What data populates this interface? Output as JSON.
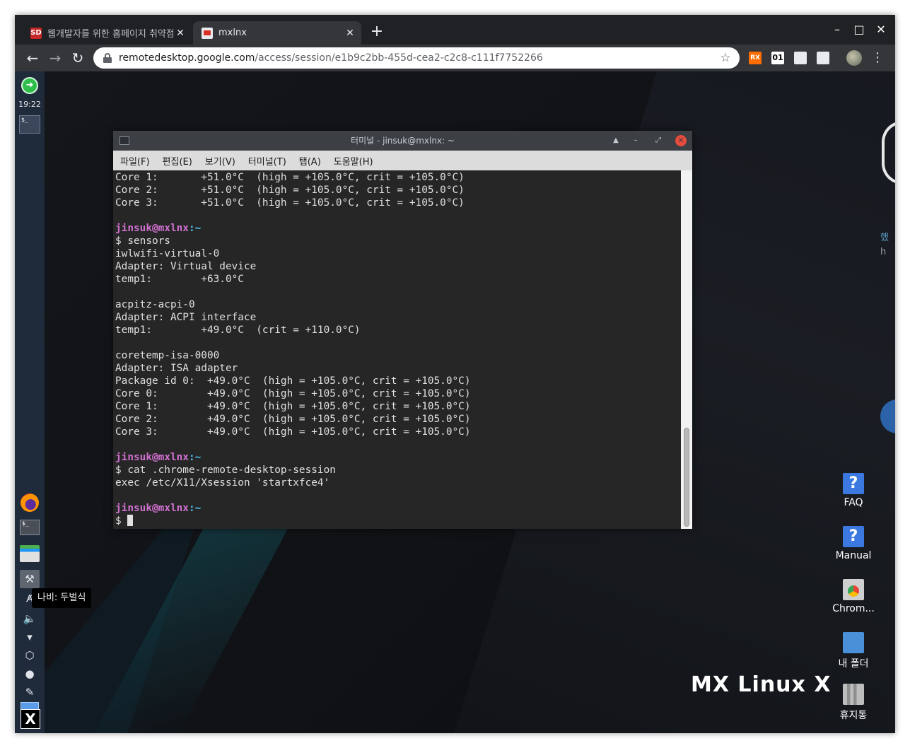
{
  "browser": {
    "tabs": [
      {
        "title": "웹개발자를 위한 홈페이지 취약점",
        "favicon": "sd-logo-icon",
        "close": "✕"
      },
      {
        "title": "mxlnx",
        "favicon": "chrome-remote-desktop-icon",
        "close": "✕"
      }
    ],
    "new_tab": "+",
    "window_controls": {
      "minimize": "–",
      "maximize": "□",
      "close": "✕"
    },
    "nav": {
      "back": "←",
      "forward": "→",
      "reload": "↻"
    },
    "url_host": "remotedesktop.google.com",
    "url_path": "/access/session/e1b9c2bb-455d-cea2-c2c8-c111f7752266",
    "star": "☆",
    "extensions": [
      {
        "name": "rx-extension-icon",
        "label": "RX"
      },
      {
        "name": "counter-extension-icon",
        "label": "01"
      },
      {
        "name": "remote-desktop-extension-icon",
        "label": ""
      },
      {
        "name": "cast-extension-icon",
        "label": ""
      }
    ],
    "menu": "⋮"
  },
  "panel": {
    "clock": "19:22",
    "tooltip": "나비: 두벌식"
  },
  "terminal": {
    "title": "터미널 - jinsuk@mxlnx: ~",
    "menu": [
      "파일(F)",
      "편집(E)",
      "보기(V)",
      "터미널(T)",
      "탭(A)",
      "도움말(H)"
    ],
    "lines": [
      {
        "t": "out",
        "text": "Core 1:       +51.0°C  (high = +105.0°C, crit = +105.0°C)"
      },
      {
        "t": "out",
        "text": "Core 2:       +51.0°C  (high = +105.0°C, crit = +105.0°C)"
      },
      {
        "t": "out",
        "text": "Core 3:       +51.0°C  (high = +105.0°C, crit = +105.0°C)"
      },
      {
        "t": "out",
        "text": ""
      },
      {
        "t": "prompt",
        "user": "jinsuk",
        "host": "mxlnx",
        "path": "~"
      },
      {
        "t": "out",
        "text": "$ sensors"
      },
      {
        "t": "out",
        "text": "iwlwifi-virtual-0"
      },
      {
        "t": "out",
        "text": "Adapter: Virtual device"
      },
      {
        "t": "out",
        "text": "temp1:        +63.0°C"
      },
      {
        "t": "out",
        "text": ""
      },
      {
        "t": "out",
        "text": "acpitz-acpi-0"
      },
      {
        "t": "out",
        "text": "Adapter: ACPI interface"
      },
      {
        "t": "out",
        "text": "temp1:        +49.0°C  (crit = +110.0°C)"
      },
      {
        "t": "out",
        "text": ""
      },
      {
        "t": "out",
        "text": "coretemp-isa-0000"
      },
      {
        "t": "out",
        "text": "Adapter: ISA adapter"
      },
      {
        "t": "out",
        "text": "Package id 0:  +49.0°C  (high = +105.0°C, crit = +105.0°C)"
      },
      {
        "t": "out",
        "text": "Core 0:        +49.0°C  (high = +105.0°C, crit = +105.0°C)"
      },
      {
        "t": "out",
        "text": "Core 1:        +49.0°C  (high = +105.0°C, crit = +105.0°C)"
      },
      {
        "t": "out",
        "text": "Core 2:        +49.0°C  (high = +105.0°C, crit = +105.0°C)"
      },
      {
        "t": "out",
        "text": "Core 3:        +49.0°C  (high = +105.0°C, crit = +105.0°C)"
      },
      {
        "t": "out",
        "text": ""
      },
      {
        "t": "prompt",
        "user": "jinsuk",
        "host": "mxlnx",
        "path": "~"
      },
      {
        "t": "out",
        "text": "$ cat .chrome-remote-desktop-session"
      },
      {
        "t": "out",
        "text": "exec /etc/X11/Xsession 'startxfce4'"
      },
      {
        "t": "out",
        "text": ""
      },
      {
        "t": "prompt",
        "user": "jinsuk",
        "host": "mxlnx",
        "path": "~"
      },
      {
        "t": "input",
        "text": "$ "
      }
    ]
  },
  "desktop": {
    "icons": [
      {
        "name": "faq",
        "label": "FAQ",
        "icon": "help-icon"
      },
      {
        "name": "manual",
        "label": "Manual",
        "icon": "help-icon"
      },
      {
        "name": "chrome",
        "label": "Chrom...",
        "icon": "chrome-remote-desktop-icon"
      },
      {
        "name": "home-folder",
        "label": "내 폴더",
        "icon": "home-folder-icon"
      },
      {
        "name": "trash",
        "label": "휴지통",
        "icon": "trash-icon"
      }
    ],
    "logo": "MX Linux X",
    "partial_text": [
      "했",
      "h"
    ]
  }
}
